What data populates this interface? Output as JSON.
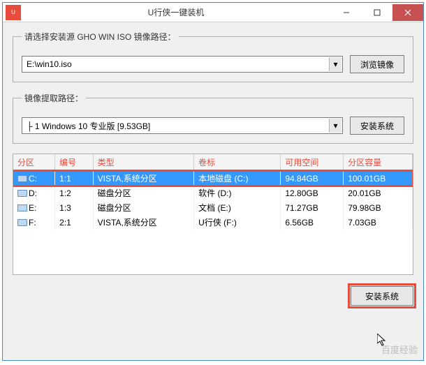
{
  "window": {
    "title": "U行侠一键装机"
  },
  "section1": {
    "legend": "请选择安装源 GHO WIN ISO 镜像路径：",
    "combo_value": "E:\\win10.iso",
    "browse_btn": "浏览镜像"
  },
  "section2": {
    "legend": "镜像提取路径：",
    "combo_value": "├ 1 Windows 10 专业版 [9.53GB]",
    "install_btn": "安装系统"
  },
  "table": {
    "headers": [
      "分区",
      "编号",
      "类型",
      "卷标",
      "可用空间",
      "分区容量"
    ],
    "rows": [
      {
        "selected": true,
        "cells": [
          "C:",
          "1:1",
          "VISTA,系统分区",
          "本地磁盘 (C:)",
          "94.84GB",
          "100.01GB"
        ]
      },
      {
        "selected": false,
        "cells": [
          "D:",
          "1:2",
          "磁盘分区",
          "软件 (D:)",
          "12.80GB",
          "20.01GB"
        ]
      },
      {
        "selected": false,
        "cells": [
          "E:",
          "1:3",
          "磁盘分区",
          "文档 (E:)",
          "71.27GB",
          "79.98GB"
        ]
      },
      {
        "selected": false,
        "cells": [
          "F:",
          "2:1",
          "VISTA,系统分区",
          "U行侠 (F:)",
          "6.56GB",
          "7.03GB"
        ]
      }
    ]
  },
  "footer": {
    "install_btn": "安装系统"
  },
  "watermark": "百度经验"
}
